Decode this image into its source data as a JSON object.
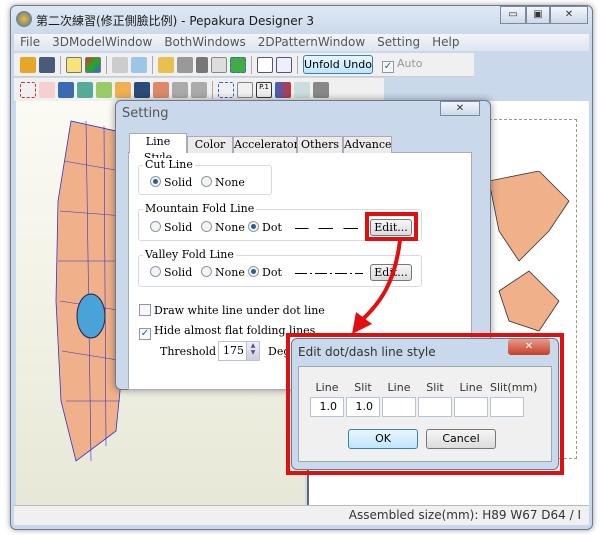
{
  "window": {
    "title": "第二次練習(修正側臉比例) - Pepakura Designer 3",
    "minimize": "▭",
    "maximize": "▣",
    "close": "✕"
  },
  "menu": [
    "File",
    "3DModelWindow",
    "BothWindows",
    "2DPatternWindow",
    "Setting",
    "Help"
  ],
  "toolbar": {
    "unfold_undo": "Unfold Undo",
    "auto_label": "Auto",
    "auto_checked": true
  },
  "status": {
    "text": "Assembled size(mm): H89 W67 D64 / I"
  },
  "setting": {
    "title": "Setting",
    "close": "✕",
    "tabs": [
      "Line Style",
      "Color",
      "Accelerator",
      "Others",
      "Advance"
    ],
    "active_tab": "Line Style",
    "cut_line": {
      "label": "Cut Line",
      "options": [
        "Solid",
        "None"
      ],
      "selected": "Solid"
    },
    "mountain": {
      "label": "Mountain Fold Line",
      "options": [
        "Solid",
        "None",
        "Dot"
      ],
      "selected": "Dot",
      "edit": "Edit..."
    },
    "valley": {
      "label": "Valley Fold Line",
      "options": [
        "Solid",
        "None",
        "Dot"
      ],
      "selected": "Dot",
      "edit": "Edit..."
    },
    "draw_white": {
      "label": "Draw white line under dot line",
      "checked": false
    },
    "hide_flat": {
      "label": "Hide almost flat folding lines",
      "checked": true
    },
    "threshold": {
      "label": "Threshold",
      "value": "175",
      "unit": "Deg"
    }
  },
  "edit_dialog": {
    "title": "Edit dot/dash line style",
    "close": "✕",
    "columns": [
      "Line",
      "Slit",
      "Line",
      "Slit",
      "Line",
      "Slit(mm)"
    ],
    "values": [
      "1.0",
      "1.0",
      "",
      "",
      "",
      ""
    ],
    "ok": "OK",
    "cancel": "Cancel"
  },
  "colors": {
    "highlight": "#e01010",
    "accent": "#245e9a"
  }
}
